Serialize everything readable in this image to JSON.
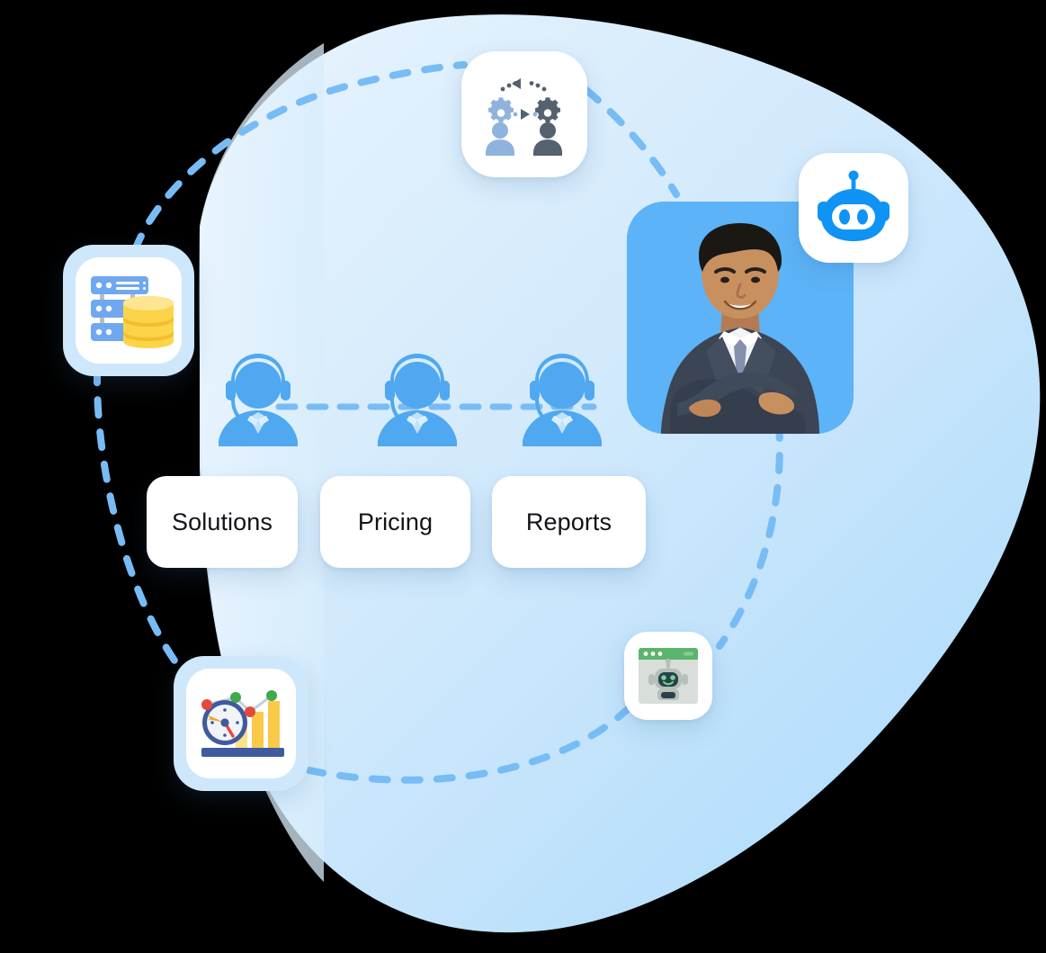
{
  "scene": {
    "title": "Customer support automation illustration",
    "background_color": "#000000",
    "blob_color_light": "#DFF0FD",
    "blob_color_mid": "#C4E3FB",
    "blob_color_deep": "#ABD9FB",
    "accent_blue": "#4FA8F0",
    "agent_blue": "#4FA8F0",
    "portrait_card_color": "#5CB3F7",
    "connector_color": "#78BCF5"
  },
  "labels": {
    "items": [
      {
        "text": "Solutions",
        "name": "solutions"
      },
      {
        "text": "Pricing",
        "name": "pricing"
      },
      {
        "text": "Reports",
        "name": "reports"
      }
    ]
  },
  "icon_cards": [
    {
      "name": "workflow-automation-card",
      "icon": "workflow-gears-people-icon",
      "description": "two gears with dotted circular arrows and two person silhouettes",
      "colors": {
        "gear_light": "#8FB3DC",
        "gear_dark": "#55616E",
        "person_light": "#8FB3DC",
        "person_dark": "#55616E"
      }
    },
    {
      "name": "robot-assistant-card",
      "icon": "robot-head-icon",
      "description": "blue robot head with antenna and two eyes",
      "colors": {
        "robot": "#0F93F5",
        "visor": "#FFFFFF"
      }
    },
    {
      "name": "database-card",
      "icon": "database-server-icon",
      "description": "blue server racks with a yellow database cylinder",
      "colors": {
        "server": "#6FA8F0",
        "database": "#FBD44A",
        "frame": "#CFE7FB"
      }
    },
    {
      "name": "analytics-card",
      "icon": "analytics-clock-chart-icon",
      "description": "clock gauge with yellow bar chart and a dotted line graph",
      "colors": {
        "clock": "#3F5A9E",
        "bars": "#FBC94A",
        "dot_red": "#E24B3B",
        "dot_green": "#3FA94B",
        "frame": "#CFE7FB"
      }
    },
    {
      "name": "chatbot-browser-card",
      "icon": "chatbot-window-icon",
      "description": "browser window with green title bar containing a grey robot",
      "colors": {
        "titlebar": "#5BB46B",
        "window": "#D8DEDA",
        "robot_face": "#29414C",
        "eyes": "#6FDB8A"
      }
    }
  ],
  "portrait": {
    "name": "support-agent-portrait",
    "alt": "Smiling businessman in a dark suit with arms crossed",
    "card_color": "#5CB3F7",
    "suit_color": "#3B4554",
    "shirt_color": "#F2F4F8",
    "tie_color": "#7E8AA8",
    "skin_color": "#C98F63",
    "hair_color": "#1B1713"
  },
  "agents": {
    "name": "support-agent-row",
    "count": 3,
    "color": "#4FA8F0",
    "description": "three headset agent silhouettes linked by a dashed line"
  },
  "connectors": [
    {
      "name": "database-to-workflow",
      "style": "dashed-curve"
    },
    {
      "name": "workflow-to-portrait",
      "style": "dashed-curve"
    },
    {
      "name": "portrait-to-chatbot",
      "style": "dashed-curve"
    },
    {
      "name": "chatbot-to-analytics",
      "style": "dashed-curve"
    },
    {
      "name": "analytics-to-database",
      "style": "dashed-curve"
    },
    {
      "name": "agent-row-link",
      "style": "dashed-line"
    }
  ]
}
